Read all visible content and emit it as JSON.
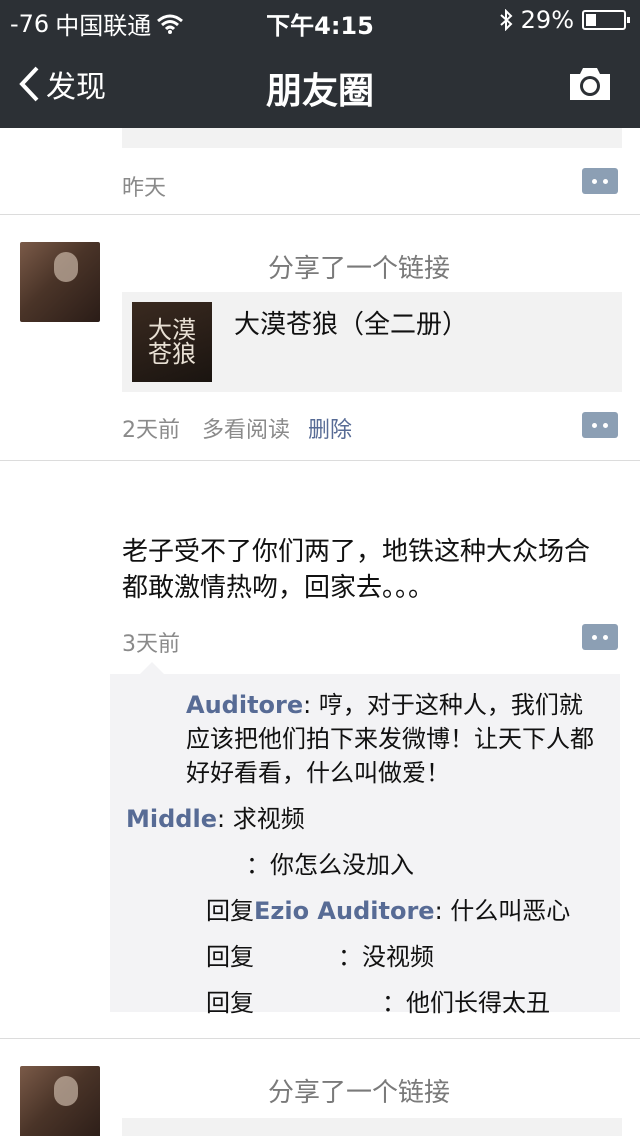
{
  "statusbar": {
    "signal": "-76",
    "carrier": "中国联通",
    "time": "下午4:15",
    "battery": "29%",
    "battery_level": 0.29
  },
  "nav": {
    "back_label": "发现",
    "title": "朋友圈"
  },
  "post0": {
    "time": "昨天"
  },
  "post1": {
    "share_text": "分享了一个链接",
    "link_thumb_text": "大漠\n苍狼",
    "link_title": "大漠苍狼（全二册）",
    "time": "2天前",
    "source": "多看阅读",
    "delete": "删除"
  },
  "post2": {
    "text": "老子受不了你们两了，地铁这种大众场合都敢激情热吻，回家去。。。",
    "time": "3天前",
    "comments": [
      {
        "name": "Auditore",
        "sep": ": ",
        "text": "哼，对于这种人，我们就应该把他们拍下来发微博！让天下人都好好看看，什么叫做爱！"
      },
      {
        "name": "Middle",
        "sep": ": ",
        "text": "求视频"
      },
      {
        "name": "",
        "sep": "：",
        "text": "你怎么没加入"
      },
      {
        "reply_word": "回复",
        "name": "Ezio Auditore",
        "sep": ": ",
        "text": "什么叫恶心"
      },
      {
        "reply_word": "回复",
        "name": "",
        "sep": "：",
        "text": "没视频"
      },
      {
        "reply_word": "回复",
        "name": "",
        "sep": "：",
        "text": "他们长得太丑"
      }
    ]
  },
  "post3": {
    "share_text": "分享了一个链接"
  }
}
